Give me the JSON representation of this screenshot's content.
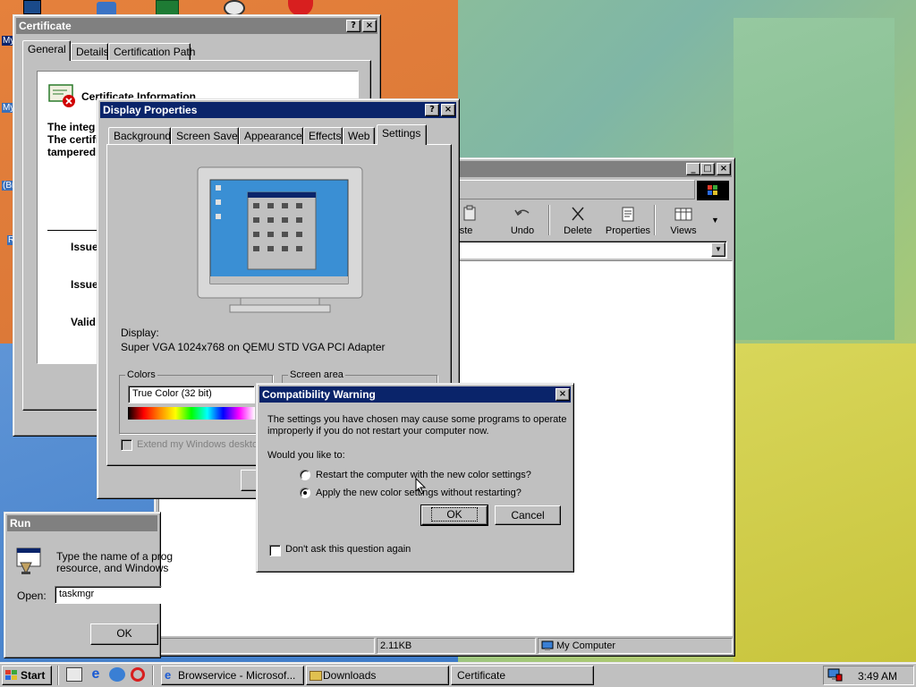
{
  "desktop": {
    "icon_labels": [
      "My",
      "My",
      "(Br",
      "R"
    ]
  },
  "certificate_window": {
    "title": "Certificate",
    "tabs": [
      "General",
      "Details",
      "Certification Path"
    ],
    "info_heading": "Certificate Information",
    "info_lines": [
      "The integ",
      "The certifi",
      "tampered"
    ],
    "fields": [
      "Issue",
      "Issue",
      "Valid"
    ]
  },
  "display_properties": {
    "title": "Display Properties",
    "tabs": [
      "Background",
      "Screen Saver",
      "Appearance",
      "Effects",
      "Web",
      "Settings"
    ],
    "display_label": "Display:",
    "display_value": "Super VGA 1024x768 on QEMU STD VGA PCI Adapter",
    "colors_label": "Colors",
    "colors_value": "True Color (32 bit)",
    "screen_area_label": "Screen area",
    "extend_label": "Extend my Windows desktop"
  },
  "explorer": {
    "toolbar": [
      "aste",
      "Undo",
      "Delete",
      "Properties",
      "Views"
    ],
    "status_size": "2.11KB",
    "status_zone": "My Computer"
  },
  "compat_warning": {
    "title": "Compatibility Warning",
    "message": "The settings you have chosen may cause some programs to operate improperly if you do not restart your computer now.",
    "question": "Would you like to:",
    "option_restart": "Restart the computer with the new color settings?",
    "option_apply": "Apply the new color settings without restarting?",
    "ok": "OK",
    "cancel": "Cancel",
    "dont_ask": "Don't ask this question again"
  },
  "run_dialog": {
    "title": "Run",
    "description_line1": "Type the name of a prog",
    "description_line2": "resource, and Windows",
    "open_label": "Open:",
    "open_value": "taskmgr",
    "ok": "OK"
  },
  "taskbar": {
    "start": "Start",
    "tasks": [
      "Browservice - Microsof...",
      "Downloads",
      "Certificate"
    ],
    "clock": "3:49 AM"
  },
  "colors": {
    "title_active": "#0a246a",
    "face": "#c0c0c0",
    "desktop_orange": "#e07a35",
    "desktop_green": "#8cc28a"
  }
}
